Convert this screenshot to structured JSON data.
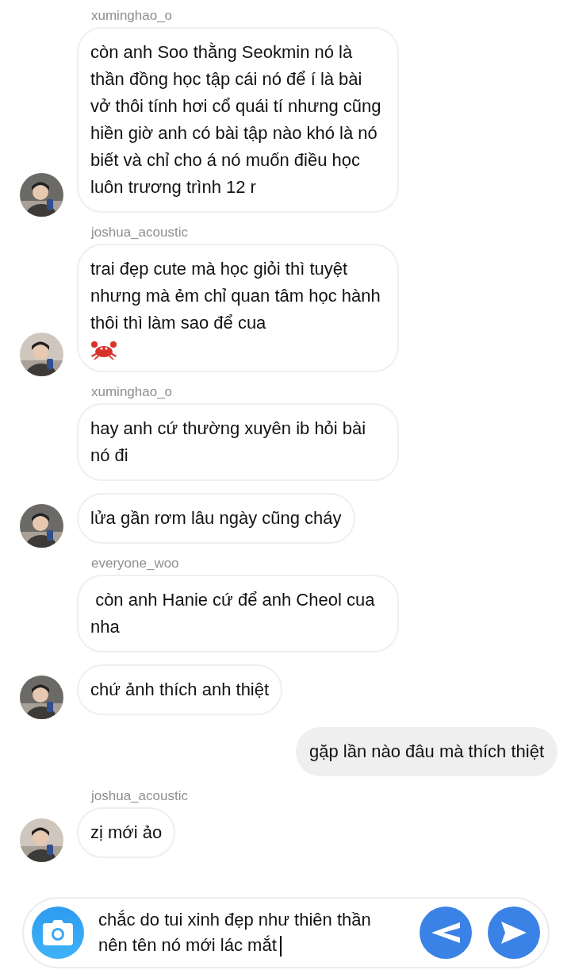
{
  "messages": [
    {
      "kind": "incoming",
      "sender": "xuminghao_o",
      "avatar": true,
      "text": "còn anh Soo thằng Seokmin nó là thần đồng học tập cái nó để í là bài vở thôi tính hơi cổ quái tí nhưng cũng hiền giờ anh có bài tập nào khó là nó biết và chỉ cho á nó muốn điều học luôn trương trình 12 r"
    },
    {
      "kind": "incoming",
      "sender": "joshua_acoustic",
      "avatar": true,
      "text": "trai đẹp cute mà học giỏi thì tuyệt nhưng mà ẻm chỉ quan tâm học hành thôi thì làm sao để cua",
      "emoji": {
        "kind": "crab"
      }
    },
    {
      "kind": "incoming",
      "sender": "xuminghao_o",
      "avatar": false,
      "text": "hay anh cứ thường xuyên ib hỏi bài nó đi"
    },
    {
      "kind": "incoming",
      "avatar": true,
      "text": "lửa gần rơm lâu ngày cũng cháy"
    },
    {
      "kind": "incoming",
      "sender": "everyone_woo",
      "avatar": false,
      "text": " còn anh Hanie cứ để anh Cheol cua nha"
    },
    {
      "kind": "incoming",
      "avatar": true,
      "text": "chứ ảnh thích anh thiệt"
    },
    {
      "kind": "outgoing",
      "text": "gặp lần nào đâu mà thích thiệt"
    },
    {
      "kind": "incoming",
      "sender": "joshua_acoustic",
      "avatar": true,
      "text": "zị mới ảo"
    }
  ],
  "composer": {
    "value": "chắc do tui xinh đẹp như thiên thần nên tên nó mới lác mắt"
  }
}
